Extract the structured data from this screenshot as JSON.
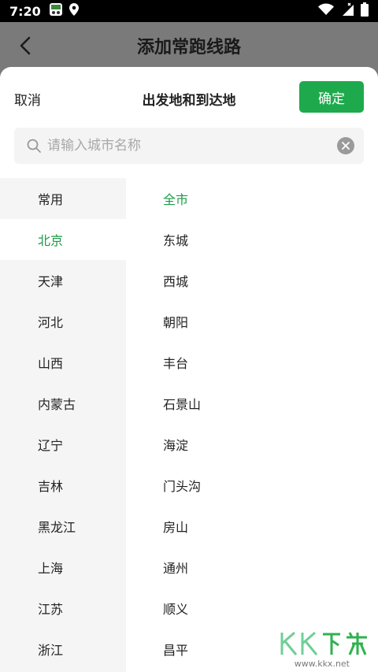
{
  "status_bar": {
    "time": "7:20"
  },
  "header": {
    "title": "添加常跑线路"
  },
  "sheet": {
    "cancel_label": "取消",
    "title": "出发地和到达地",
    "confirm_label": "确定"
  },
  "search": {
    "placeholder": "请输入城市名称",
    "value": ""
  },
  "provinces": [
    {
      "label": "常用"
    },
    {
      "label": "北京"
    },
    {
      "label": "天津"
    },
    {
      "label": "河北"
    },
    {
      "label": "山西"
    },
    {
      "label": "内蒙古"
    },
    {
      "label": "辽宁"
    },
    {
      "label": "吉林"
    },
    {
      "label": "黑龙江"
    },
    {
      "label": "上海"
    },
    {
      "label": "江苏"
    },
    {
      "label": "浙江"
    }
  ],
  "districts": [
    {
      "label": "全市"
    },
    {
      "label": "东城"
    },
    {
      "label": "西城"
    },
    {
      "label": "朝阳"
    },
    {
      "label": "丰台"
    },
    {
      "label": "石景山"
    },
    {
      "label": "海淀"
    },
    {
      "label": "门头沟"
    },
    {
      "label": "房山"
    },
    {
      "label": "通州"
    },
    {
      "label": "顺义"
    },
    {
      "label": "昌平"
    }
  ],
  "watermark": {
    "logo_text": "KK下载",
    "url": "www.kkx.net"
  },
  "colors": {
    "accent": "#1eaa4c",
    "selected_text": "#1a9a46",
    "overlay": "#7a7a7a"
  }
}
